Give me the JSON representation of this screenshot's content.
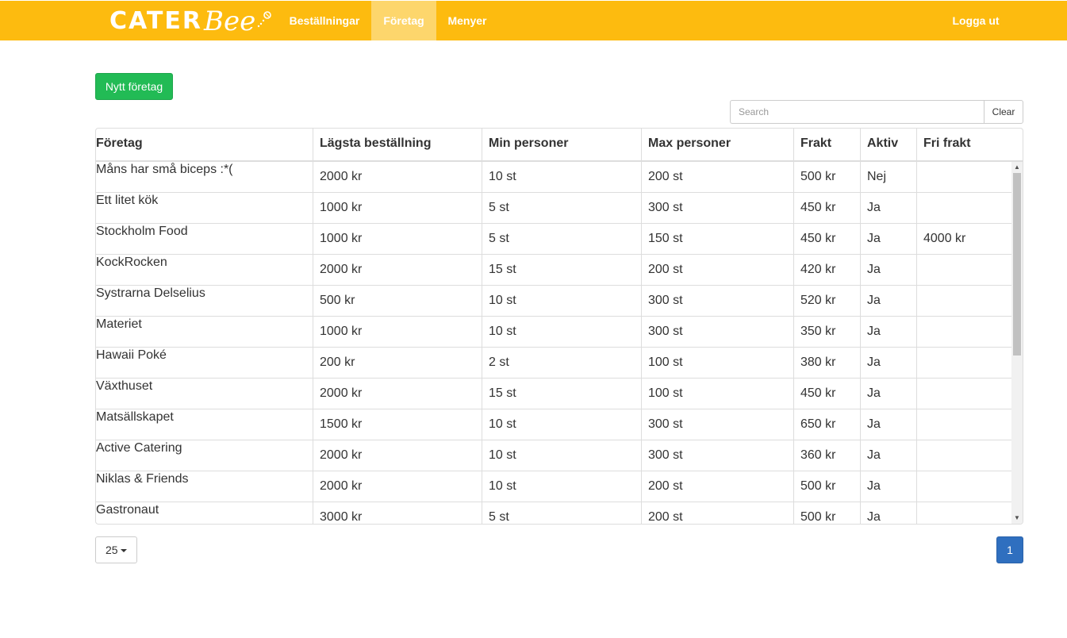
{
  "brand": {
    "logo_primary": "CATER",
    "logo_secondary": "Bee"
  },
  "nav": {
    "orders": "Beställningar",
    "companies": "Företag",
    "menus": "Menyer",
    "logout": "Logga ut",
    "active": "companies"
  },
  "actions": {
    "new_company": "Nytt företag"
  },
  "search": {
    "placeholder": "Search",
    "value": "",
    "clear_label": "Clear"
  },
  "table": {
    "headers": [
      "Företag",
      "Lägsta beställning",
      "Min personer",
      "Max personer",
      "Frakt",
      "Aktiv",
      "Fri frakt"
    ],
    "rows": [
      [
        "Måns har små biceps :*(",
        "2000 kr",
        "10 st",
        "200 st",
        "500 kr",
        "Nej",
        ""
      ],
      [
        "Ett litet kök",
        "1000 kr",
        "5 st",
        "300 st",
        "450 kr",
        "Ja",
        ""
      ],
      [
        "Stockholm Food",
        "1000 kr",
        "5 st",
        "150 st",
        "450 kr",
        "Ja",
        "4000 kr"
      ],
      [
        "KockRocken",
        "2000 kr",
        "15 st",
        "200 st",
        "420 kr",
        "Ja",
        ""
      ],
      [
        "Systrarna Delselius",
        "500 kr",
        "10 st",
        "300 st",
        "520 kr",
        "Ja",
        ""
      ],
      [
        "Materiet",
        "1000 kr",
        "10 st",
        "300 st",
        "350 kr",
        "Ja",
        ""
      ],
      [
        "Hawaii Poké",
        "200 kr",
        "2 st",
        "100 st",
        "380 kr",
        "Ja",
        ""
      ],
      [
        "Växthuset",
        "2000 kr",
        "15 st",
        "100 st",
        "450 kr",
        "Ja",
        ""
      ],
      [
        "Matsällskapet",
        "1500 kr",
        "10 st",
        "300 st",
        "650 kr",
        "Ja",
        ""
      ],
      [
        "Active Catering",
        "2000 kr",
        "10 st",
        "300 st",
        "360 kr",
        "Ja",
        ""
      ],
      [
        "Niklas & Friends",
        "2000 kr",
        "10 st",
        "200 st",
        "500 kr",
        "Ja",
        ""
      ],
      [
        "Gastronaut",
        "3000 kr",
        "5 st",
        "200 st",
        "500 kr",
        "Ja",
        ""
      ]
    ]
  },
  "pagination": {
    "page_size": "25",
    "current_page": "1"
  },
  "colors": {
    "navbar": "#fdbb0f",
    "nav_active": "#fdd66c",
    "primary_action": "#22bb55",
    "page_active": "#2f6fbf"
  }
}
